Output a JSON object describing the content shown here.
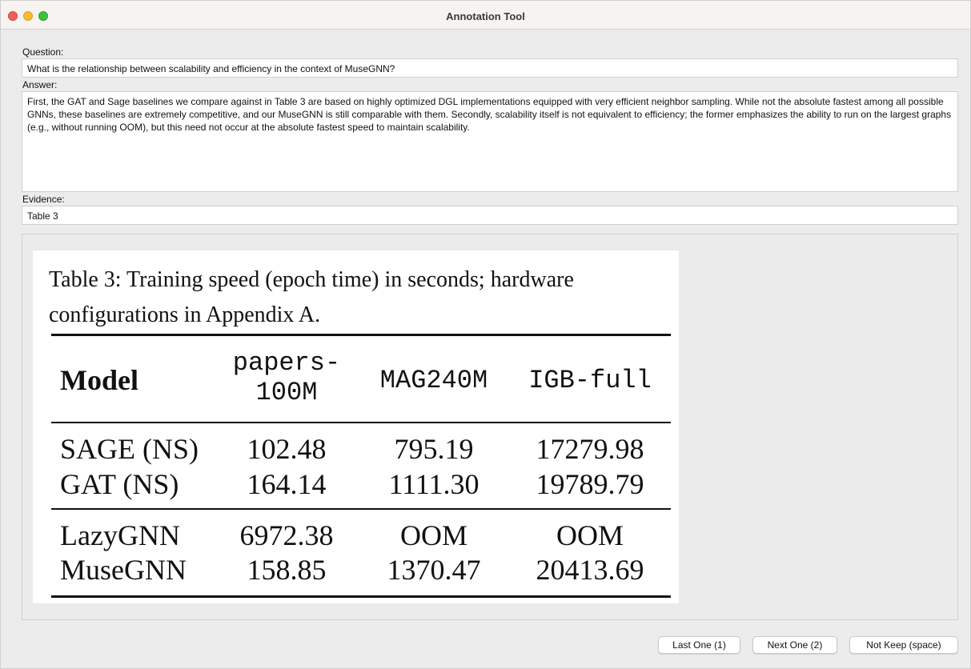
{
  "window": {
    "title": "Annotation Tool"
  },
  "question": {
    "label": "Question:",
    "value": "What is the relationship between scalability and efficiency in the context of MuseGNN?"
  },
  "answer": {
    "label": "Answer:",
    "value": "First, the GAT and Sage baselines we compare against in Table 3 are based on highly optimized DGL implementations equipped with very efficient neighbor sampling. While not the absolute fastest among all possible GNNs, these baselines are extremely competitive, and our MuseGNN is still comparable with them. Secondly, scalability itself is not equivalent to efficiency; the former emphasizes the ability to run on the largest graphs (e.g., without running OOM), but this need not occur at the absolute fastest speed to maintain scalability."
  },
  "evidence": {
    "label": "Evidence:",
    "value": "Table 3"
  },
  "table": {
    "caption_line1": "Table 3: Training speed (epoch time) in seconds; hardware",
    "caption_line2": "configurations in Appendix A.",
    "header": {
      "model": "Model",
      "col1_line1": "papers-",
      "col1_line2": "100M",
      "col2": "MAG240M",
      "col3": "IGB-full"
    },
    "rows": [
      {
        "model": "SAGE (NS)",
        "c1": "102.48",
        "c2": "795.19",
        "c3": "17279.98"
      },
      {
        "model": "GAT (NS)",
        "c1": "164.14",
        "c2": "1111.30",
        "c3": "19789.79"
      },
      {
        "model": "LazyGNN",
        "c1": "6972.38",
        "c2": "OOM",
        "c3": "OOM"
      },
      {
        "model": "MuseGNN",
        "c1": "158.85",
        "c2": "1370.47",
        "c3": "20413.69"
      }
    ]
  },
  "buttons": {
    "last": "Last One (1)",
    "next": "Next One (2)",
    "not_keep": "Not Keep (space)"
  }
}
